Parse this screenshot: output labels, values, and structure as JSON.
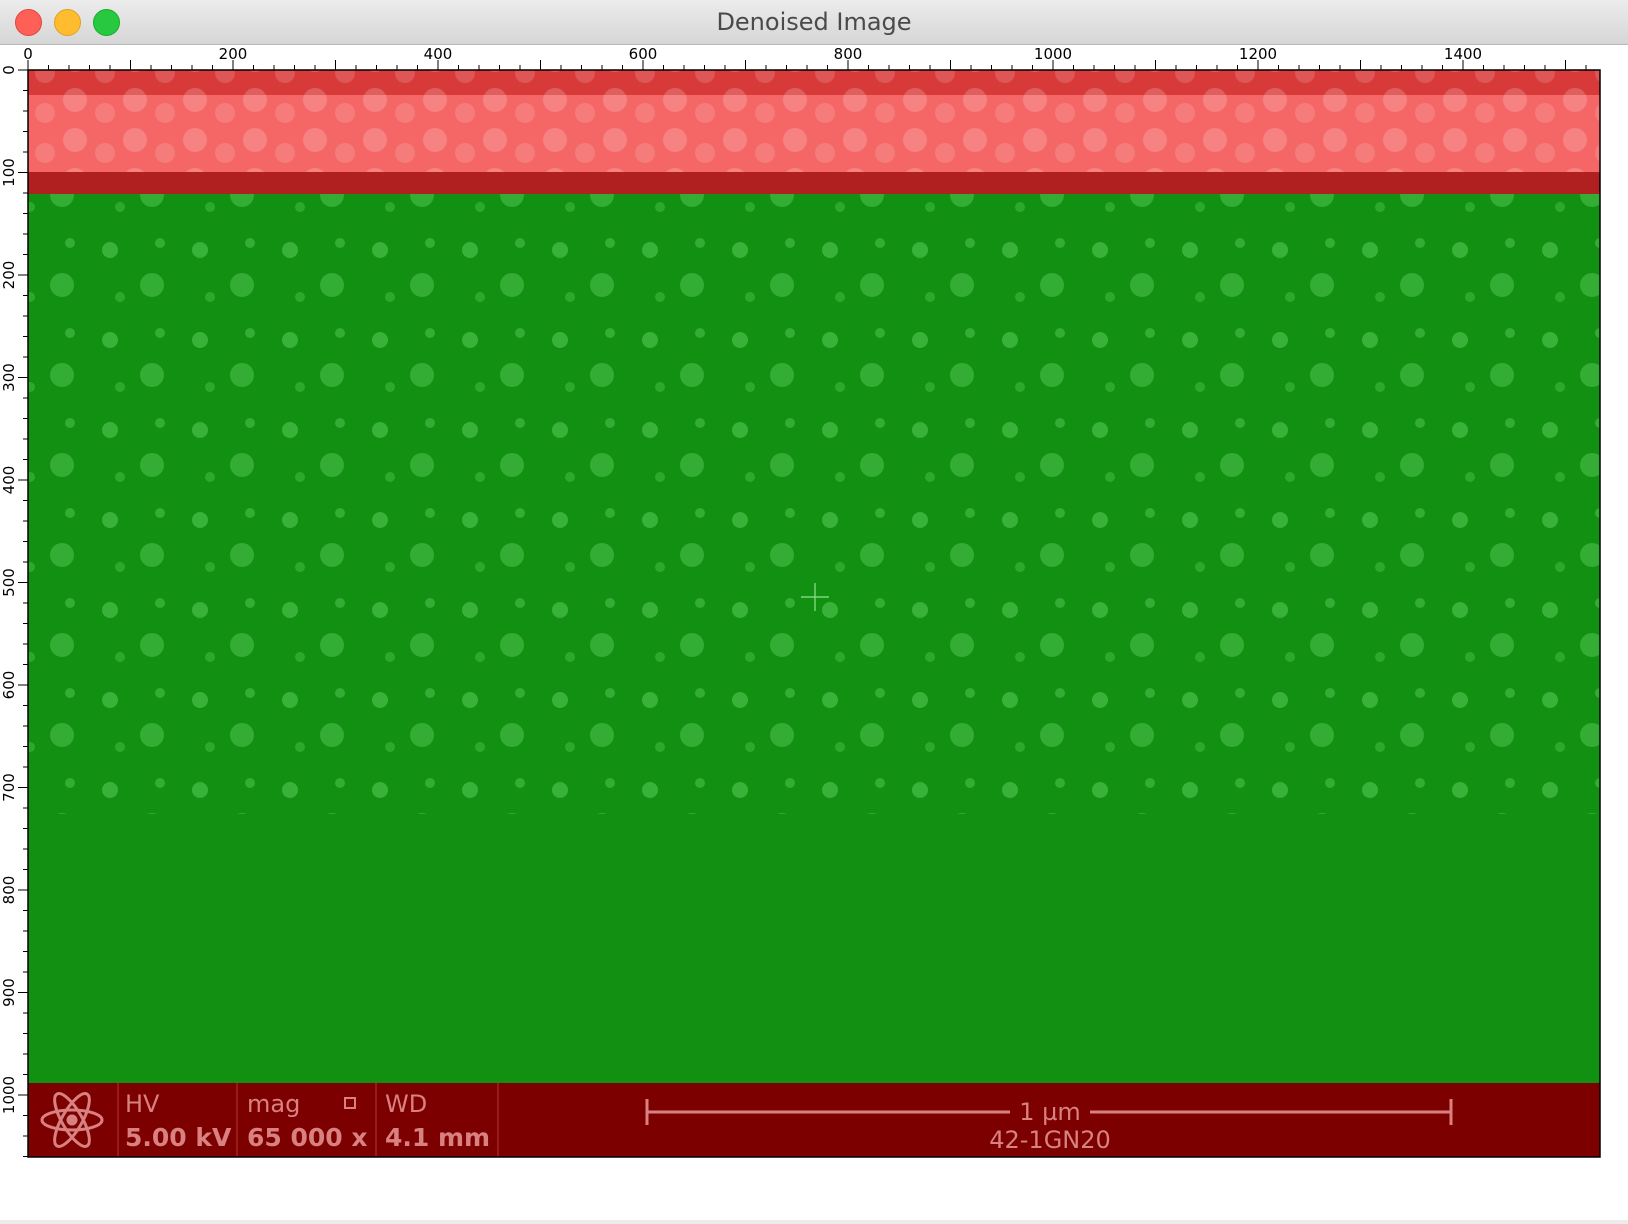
{
  "window": {
    "title": "Denoised Image"
  },
  "image": {
    "top_layer_color": "#ff5a5a",
    "bottom_layer_color": "#19a019",
    "info_bar_color": "#7d0000"
  },
  "rulers": {
    "x_ticks": [
      "0",
      "200",
      "400",
      "600",
      "800",
      "1000",
      "1200",
      "1400"
    ],
    "y_ticks": [
      "0",
      "100",
      "200",
      "300",
      "400",
      "500",
      "600",
      "700",
      "800",
      "900",
      "1000"
    ]
  },
  "info_bar": {
    "hv_label": "HV",
    "hv_value": "5.00 kV",
    "mag_label": "mag",
    "mag_value": "65 000 x",
    "wd_label": "WD",
    "wd_value": "4.1 mm",
    "scale_label": "1 µm",
    "sample_id": "42-1GN20",
    "logo_icon": "atom-icon",
    "mag_icon": "small-square-icon"
  },
  "cursor": {
    "icon": "crosshair-icon"
  }
}
